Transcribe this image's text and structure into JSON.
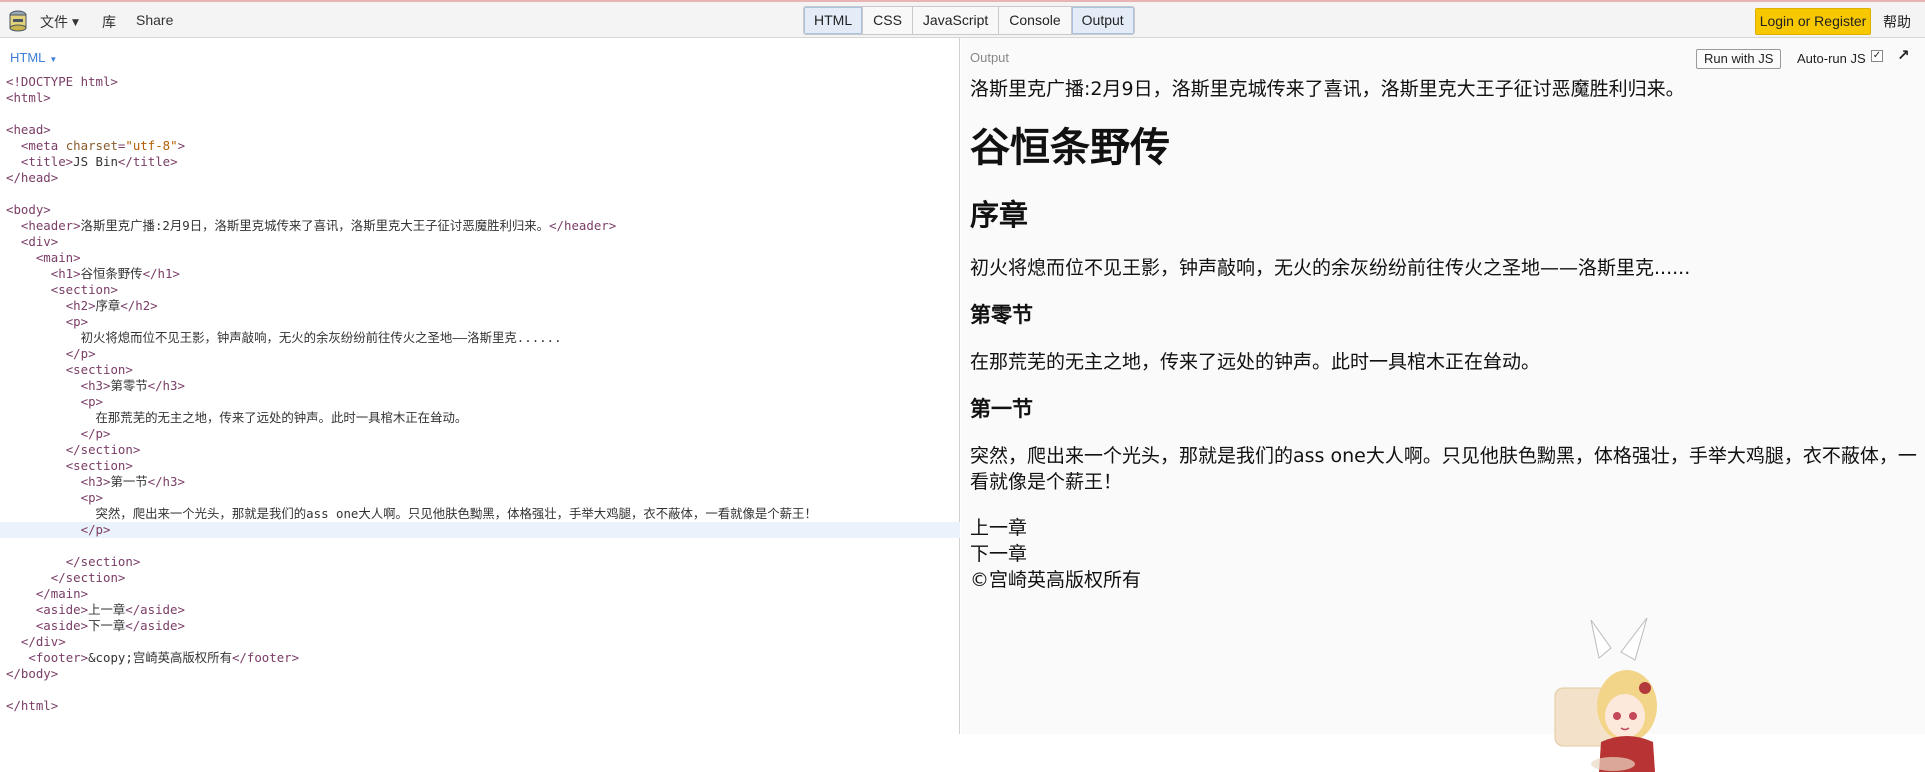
{
  "menu": {
    "file": "文件",
    "library": "库",
    "share": "Share"
  },
  "panels": [
    "HTML",
    "CSS",
    "JavaScript",
    "Console",
    "Output"
  ],
  "active_panels": [
    "HTML",
    "Output"
  ],
  "auth": {
    "login": "Login or Register",
    "help": "帮助"
  },
  "editor": {
    "label": "HTML",
    "lines": [
      [
        [
          "tag",
          "<!DOCTYPE html>"
        ]
      ],
      [
        [
          "tag",
          "<html>"
        ]
      ],
      [],
      [
        [
          "tag",
          "<head>"
        ]
      ],
      [
        [
          "txt",
          "  "
        ],
        [
          "tag",
          "<meta "
        ],
        [
          "attr",
          "charset"
        ],
        [
          "tag",
          "="
        ],
        [
          "str",
          "\"utf-8\""
        ],
        [
          "tag",
          ">"
        ]
      ],
      [
        [
          "txt",
          "  "
        ],
        [
          "tag",
          "<title>"
        ],
        [
          "txt",
          "JS Bin"
        ],
        [
          "tag",
          "</title>"
        ]
      ],
      [
        [
          "tag",
          "</head>"
        ]
      ],
      [],
      [
        [
          "tag",
          "<body>"
        ]
      ],
      [
        [
          "txt",
          "  "
        ],
        [
          "tag",
          "<header>"
        ],
        [
          "txt",
          "洛斯里克广播:2月9日，洛斯里克城传来了喜讯，洛斯里克大王子征讨恶魔胜利归来。"
        ],
        [
          "tag",
          "</header>"
        ]
      ],
      [
        [
          "txt",
          "  "
        ],
        [
          "tag",
          "<div>"
        ]
      ],
      [
        [
          "txt",
          "    "
        ],
        [
          "tag",
          "<main>"
        ]
      ],
      [
        [
          "txt",
          "      "
        ],
        [
          "tag",
          "<h1>"
        ],
        [
          "txt",
          "谷恒条野传"
        ],
        [
          "tag",
          "</h1>"
        ]
      ],
      [
        [
          "txt",
          "      "
        ],
        [
          "tag",
          "<section>"
        ]
      ],
      [
        [
          "txt",
          "        "
        ],
        [
          "tag",
          "<h2>"
        ],
        [
          "txt",
          "序章"
        ],
        [
          "tag",
          "</h2>"
        ]
      ],
      [
        [
          "txt",
          "        "
        ],
        [
          "tag",
          "<p>"
        ]
      ],
      [
        [
          "txt",
          "          初火将熄而位不见王影，钟声敲响，无火的余灰纷纷前往传火之圣地——洛斯里克......"
        ]
      ],
      [
        [
          "txt",
          "        "
        ],
        [
          "tag",
          "</p>"
        ]
      ],
      [
        [
          "txt",
          "        "
        ],
        [
          "tag",
          "<section>"
        ]
      ],
      [
        [
          "txt",
          "          "
        ],
        [
          "tag",
          "<h3>"
        ],
        [
          "txt",
          "第零节"
        ],
        [
          "tag",
          "</h3>"
        ]
      ],
      [
        [
          "txt",
          "          "
        ],
        [
          "tag",
          "<p>"
        ]
      ],
      [
        [
          "txt",
          "            在那荒芜的无主之地，传来了远处的钟声。此时一具棺木正在耸动。"
        ]
      ],
      [
        [
          "txt",
          "          "
        ],
        [
          "tag",
          "</p>"
        ]
      ],
      [
        [
          "txt",
          "        "
        ],
        [
          "tag",
          "</section>"
        ]
      ],
      [
        [
          "txt",
          "        "
        ],
        [
          "tag",
          "<section>"
        ]
      ],
      [
        [
          "txt",
          "          "
        ],
        [
          "tag",
          "<h3>"
        ],
        [
          "txt",
          "第一节"
        ],
        [
          "tag",
          "</h3>"
        ]
      ],
      [
        [
          "txt",
          "          "
        ],
        [
          "tag",
          "<p>"
        ]
      ],
      [
        [
          "txt",
          "            突然，爬出来一个光头，那就是我们的ass one大人啊。只见他肤色黝黑，体格强壮，手举大鸡腿，衣不蔽体，一看就像是个薪王！"
        ]
      ],
      [
        [
          "txt",
          "          "
        ],
        [
          "tag",
          "</p>"
        ]
      ],
      [],
      [
        [
          "txt",
          "        "
        ],
        [
          "tag",
          "</section>"
        ]
      ],
      [
        [
          "txt",
          "      "
        ],
        [
          "tag",
          "</section>"
        ]
      ],
      [
        [
          "txt",
          "    "
        ],
        [
          "tag",
          "</main>"
        ]
      ],
      [
        [
          "txt",
          "    "
        ],
        [
          "tag",
          "<aside>"
        ],
        [
          "txt",
          "上一章"
        ],
        [
          "tag",
          "</aside>"
        ]
      ],
      [
        [
          "txt",
          "    "
        ],
        [
          "tag",
          "<aside>"
        ],
        [
          "txt",
          "下一章"
        ],
        [
          "tag",
          "</aside>"
        ]
      ],
      [
        [
          "txt",
          "  "
        ],
        [
          "tag",
          "</div>"
        ]
      ],
      [
        [
          "txt",
          "   "
        ],
        [
          "tag",
          "<footer>"
        ],
        [
          "txt",
          "&copy;宫崎英高版权所有"
        ],
        [
          "tag",
          "</footer>"
        ]
      ],
      [
        [
          "tag",
          "</body>"
        ]
      ],
      [],
      [
        [
          "tag",
          "</html>"
        ]
      ]
    ],
    "highlighted_line": 28
  },
  "output": {
    "label": "Output",
    "run_button": "Run with JS",
    "autorun_label": "Auto-run JS",
    "autorun_checked": true,
    "page": {
      "header": "洛斯里克广播:2月9日，洛斯里克城传来了喜讯，洛斯里克大王子征讨恶魔胜利归来。",
      "h1": "谷恒条野传",
      "h2": "序章",
      "p_prologue": "初火将熄而位不见王影，钟声敲响，无火的余灰纷纷前往传火之圣地——洛斯里克......",
      "h3_zero": "第零节",
      "p_zero": "在那荒芜的无主之地，传来了远处的钟声。此时一具棺木正在耸动。",
      "h3_one": "第一节",
      "p_one": "突然，爬出来一个光头，那就是我们的ass one大人啊。只见他肤色黝黑，体格强壮，手举大鸡腿，衣不蔽体，一看就像是个薪王！",
      "aside_prev": "上一章",
      "aside_next": "下一章",
      "footer": "©宫崎英高版权所有"
    }
  },
  "colors": {
    "accent_yellow": "#f7c800",
    "tag": "#7a3d66",
    "string": "#b35c00",
    "editor_label": "#3d7ed8",
    "highlight": "#eaf2fb"
  },
  "icons": {
    "logo": "jsbin-logo-icon",
    "popout": "popout-arrow-icon",
    "mascot": "anime-mascot-sticker"
  }
}
